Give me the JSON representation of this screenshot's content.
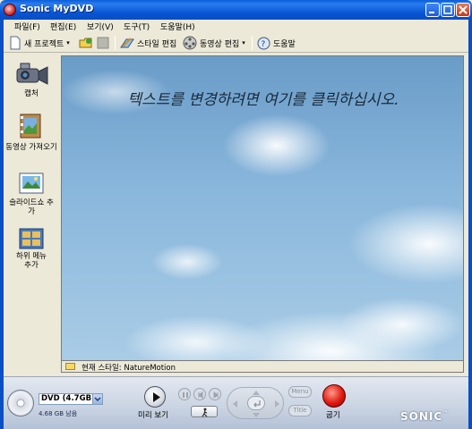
{
  "window": {
    "title": "Sonic MyDVD"
  },
  "menu": [
    "파일(F)",
    "편집(E)",
    "보기(V)",
    "도구(T)",
    "도움말(H)"
  ],
  "toolbar": {
    "new_project": "새 프로젝트",
    "edit_style": "스타일 편집",
    "edit_video": "동영상 편집",
    "help": "도움말"
  },
  "sidebar": [
    {
      "label": "캡처",
      "icon": "camcorder-icon"
    },
    {
      "label": "동영상 가져오기",
      "icon": "film-import-icon"
    },
    {
      "label": "슬라이드쇼 추가",
      "icon": "slideshow-icon"
    },
    {
      "label": "하위 메뉴 추가",
      "icon": "submenu-icon"
    }
  ],
  "preview": {
    "title_text": "텍스트를 변경하려면 여기를 클릭하십시오.",
    "current_style_label": "현재 스타일: NatureMotion"
  },
  "bottom": {
    "disc_type": "DVD (4.7GB)",
    "free_space": "4.68 GB 남음",
    "preview_label": "미리 보기",
    "menu_pill": "Menu",
    "title_pill": "Title",
    "burn_label": "굽기",
    "brand": "SONIC"
  },
  "colors": {
    "title_bar": "#0a5fd8",
    "burn": "#e01a10"
  }
}
